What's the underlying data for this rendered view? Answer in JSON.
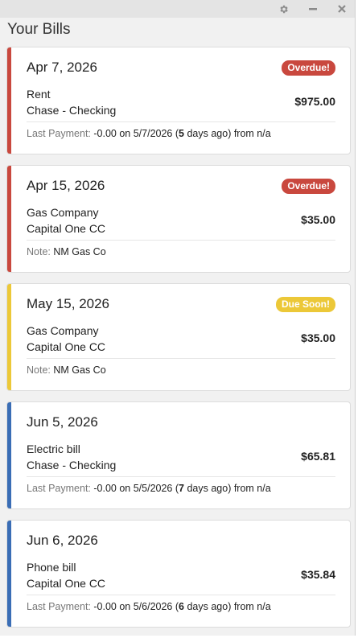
{
  "window": {
    "title": "Your Bills",
    "controls": [
      "gear-icon",
      "minimize-icon",
      "close-icon"
    ]
  },
  "colors": {
    "overdue": "#c9483e",
    "due_soon": "#ecc838",
    "upcoming": "#3a6db5"
  },
  "bills": [
    {
      "date": "Apr 7, 2026",
      "badge": "Overdue!",
      "status": "overdue",
      "payee": "Rent",
      "account": "Chase - Checking",
      "amount": "$975.00",
      "footer_label": "Last Payment:",
      "footer_pre": "-0.00 on 5/7/2026 (",
      "footer_bold": "5",
      "footer_post": " days ago) from n/a"
    },
    {
      "date": "Apr 15, 2026",
      "badge": "Overdue!",
      "status": "overdue",
      "payee": "Gas Company",
      "account": "Capital One CC",
      "amount": "$35.00",
      "footer_label": "Note:",
      "footer_pre": "NM Gas Co",
      "footer_bold": "",
      "footer_post": ""
    },
    {
      "date": "May 15, 2026",
      "badge": "Due Soon!",
      "status": "due_soon",
      "payee": "Gas Company",
      "account": "Capital One CC",
      "amount": "$35.00",
      "footer_label": "Note:",
      "footer_pre": "NM Gas Co",
      "footer_bold": "",
      "footer_post": ""
    },
    {
      "date": "Jun 5, 2026",
      "badge": "",
      "status": "upcoming",
      "payee": "Electric bill",
      "account": "Chase - Checking",
      "amount": "$65.81",
      "footer_label": "Last Payment:",
      "footer_pre": "-0.00 on 5/5/2026 (",
      "footer_bold": "7",
      "footer_post": " days ago) from n/a"
    },
    {
      "date": "Jun 6, 2026",
      "badge": "",
      "status": "upcoming",
      "payee": "Phone bill",
      "account": "Capital One CC",
      "amount": "$35.84",
      "footer_label": "Last Payment:",
      "footer_pre": "-0.00 on 5/6/2026 (",
      "footer_bold": "6",
      "footer_post": " days ago) from n/a"
    }
  ]
}
